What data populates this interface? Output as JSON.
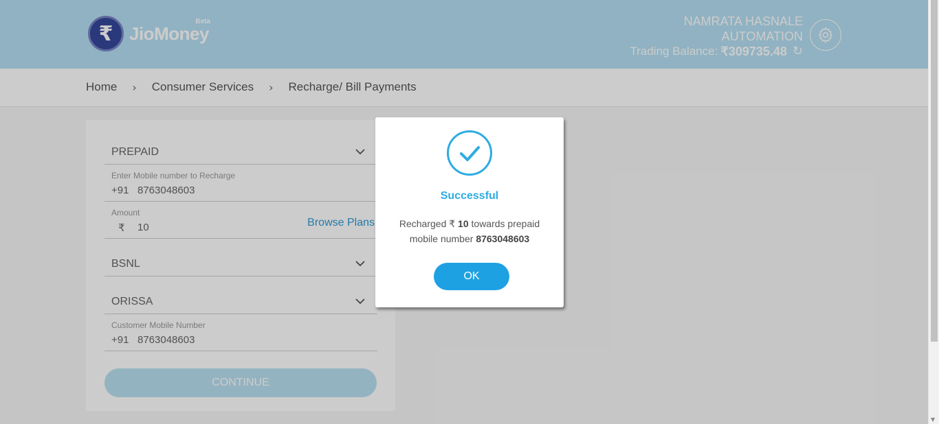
{
  "brand": {
    "logo_glyph": "₹",
    "name": "JioMoney",
    "beta": "Beta",
    "color": "#35489a"
  },
  "header": {
    "user_name": "NAMRATA HASNALE",
    "company": "AUTOMATION",
    "balance_label": "Trading Balance:",
    "balance_value": "₹309735.48",
    "background": "#b5dff3"
  },
  "breadcrumb": [
    "Home",
    "Consumer Services",
    "Recharge/ Bill Payments"
  ],
  "form": {
    "recharge_type": "PREPAID",
    "mobile_label": "Enter Mobile number to Recharge",
    "mobile_prefix": "+91",
    "mobile_value": "8763048603",
    "amount_label": "Amount",
    "currency_symbol": "₹",
    "amount_value": "10",
    "browse_plans": "Browse Plans",
    "operator": "BSNL",
    "circle": "ORISSA",
    "customer_mobile_label": "Customer Mobile Number",
    "customer_mobile_prefix": "+91",
    "customer_mobile_value": "8763048603",
    "continue_label": "CONTINUE"
  },
  "modal": {
    "title": "Successful",
    "msg_part1": "Recharged ₹ ",
    "amount": "10",
    "msg_part2": " towards prepaid",
    "msg_part3": "mobile number ",
    "mobile": "8763048603",
    "ok_label": "OK",
    "accent": "#2eabe2"
  }
}
